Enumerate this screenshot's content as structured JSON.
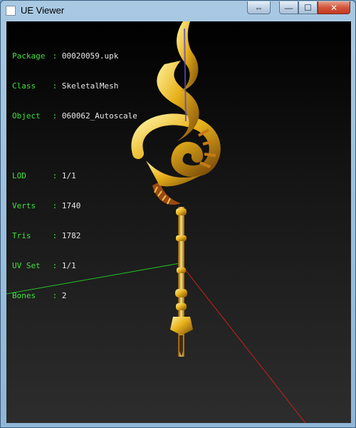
{
  "window": {
    "title": "UE Viewer"
  },
  "controls": {
    "swap": "⇔",
    "minimize": "—",
    "maximize": "☐",
    "close": "✕"
  },
  "info_group1": [
    {
      "key": "Package",
      "sep": ":",
      "value": "00020059.upk"
    },
    {
      "key": "Class",
      "sep": ":",
      "value": "SkeletalMesh"
    },
    {
      "key": "Object",
      "sep": ":",
      "value": "060062_Autoscale"
    }
  ],
  "info_group2": [
    {
      "key": "LOD",
      "sep": ":",
      "value": "1/1"
    },
    {
      "key": "Verts",
      "sep": ":",
      "value": "1740"
    },
    {
      "key": "Tris",
      "sep": ":",
      "value": "1782"
    },
    {
      "key": "UV Set",
      "sep": ":",
      "value": "1/1"
    },
    {
      "key": "Bones",
      "sep": ":",
      "value": "2"
    }
  ],
  "colors": {
    "label": "#3ee03e",
    "value": "#e8e8e8",
    "axis_x": "#cc1f1f",
    "axis_y": "#23c423",
    "gold": "#e8b21c"
  }
}
